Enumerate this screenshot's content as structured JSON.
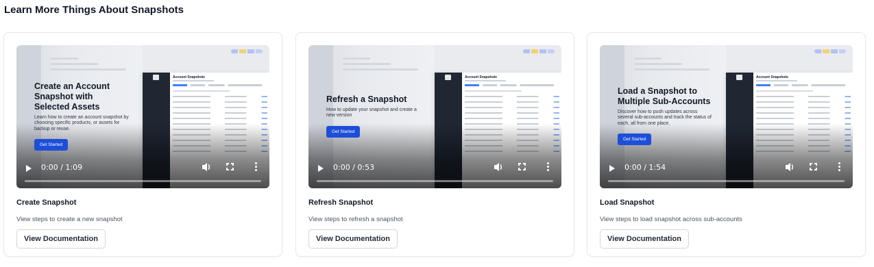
{
  "section": {
    "title": "Learn More Things About Snapshots"
  },
  "colors": {
    "accent": "#1d4ed8",
    "app_sidebar": "#202733",
    "card_border": "#e5e7eb"
  },
  "cards": [
    {
      "video": {
        "overlay_title": "Create an Account Snapshot with Selected Assets",
        "overlay_desc": "Learn how to create an account snapshot by choosing specific products, or assets for backup or reuse.",
        "overlay_button": "Get Started",
        "app_heading": "Account Snapshots",
        "time": "0:00 / 1:09",
        "progress": 0
      },
      "title": "Create Snapshot",
      "description": "View steps to create a new snapshot",
      "button": "View Documentation"
    },
    {
      "video": {
        "overlay_title": "Refresh a Snapshot",
        "overlay_desc": "How to update your snapshot and create a new version",
        "overlay_button": "Get Started",
        "app_heading": "Account Snapshots",
        "time": "0:00 / 0:53",
        "progress": 0
      },
      "title": "Refresh Snapshot",
      "description": "View steps to refresh a snapshot",
      "button": "View Documentation"
    },
    {
      "video": {
        "overlay_title": "Load a Snapshot to Multiple Sub-Accounts",
        "overlay_desc": "Discover how to push updates across several sub-accounts and track the status of each, all from one place.",
        "overlay_button": "Get Started",
        "app_heading": "Account Snapshots",
        "time": "0:00 / 1:54",
        "progress": 0
      },
      "title": "Load Snapshot",
      "description": "View steps to load snapshot across sub-accounts",
      "button": "View Documentation"
    }
  ],
  "icons": [
    "play-icon",
    "volume-icon",
    "fullscreen-icon",
    "more-options-icon"
  ]
}
